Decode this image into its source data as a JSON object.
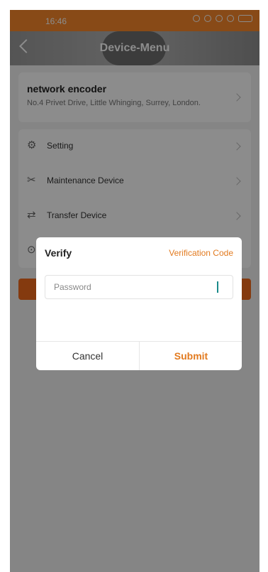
{
  "status_bar": {
    "time": "16:46"
  },
  "header": {
    "title": "Device-Menu"
  },
  "device": {
    "name": "network encoder",
    "address": "No.4 Privet Drive, Little Whinging, Surrey, London."
  },
  "menu": [
    {
      "label": "Setting",
      "icon": "gear-icon"
    },
    {
      "label": "Maintenance Device",
      "icon": "tools-icon"
    },
    {
      "label": "Transfer Device",
      "icon": "transfer-icon"
    },
    {
      "label": "",
      "icon": "upgrade-icon"
    }
  ],
  "dialog": {
    "title": "Verify",
    "link": "Verification Code",
    "password_placeholder": "Password",
    "cancel": "Cancel",
    "submit": "Submit"
  },
  "colors": {
    "accent": "#f7882a",
    "link": "#e27a1f",
    "button": "#f16a1c"
  }
}
